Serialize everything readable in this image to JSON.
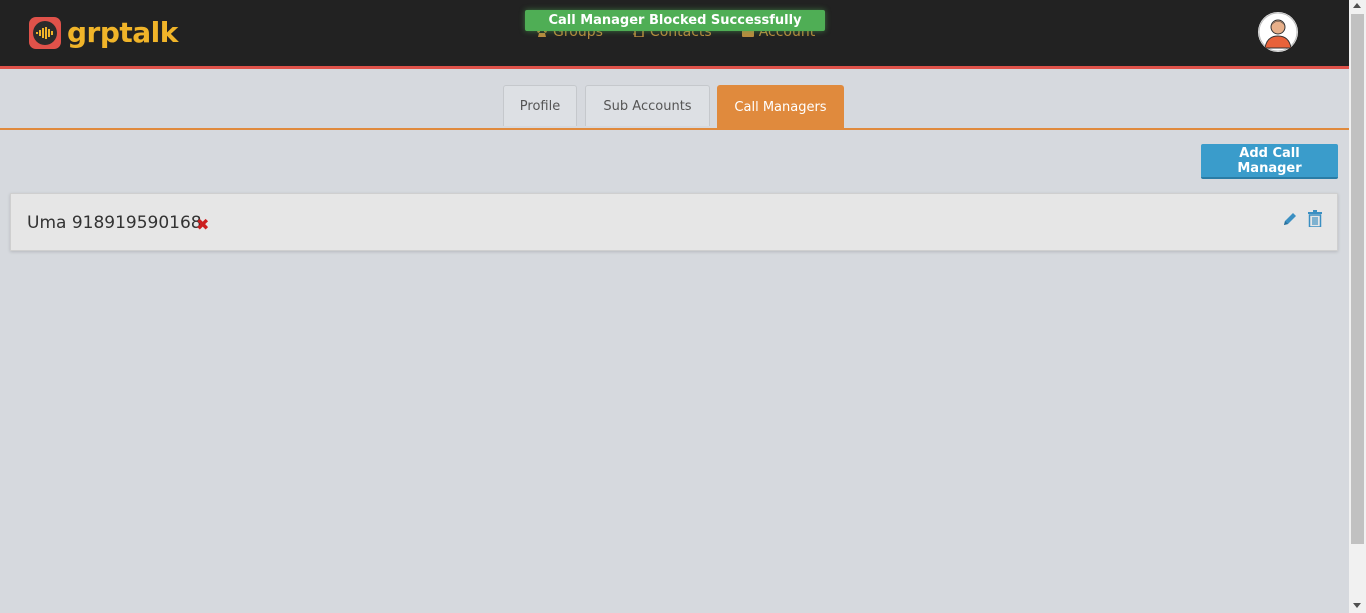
{
  "header": {
    "logo_text": "grptalk",
    "nav": [
      {
        "label": "Groups",
        "icon": "phone-icon"
      },
      {
        "label": "Contacts",
        "icon": "contacts-book-icon"
      },
      {
        "label": "Account",
        "icon": "briefcase-icon"
      }
    ],
    "toast": "Call Manager Blocked Successfully"
  },
  "tabs": [
    {
      "label": "Profile",
      "active": false
    },
    {
      "label": "Sub Accounts",
      "active": false
    },
    {
      "label": "Call Managers",
      "active": true
    }
  ],
  "toolbar": {
    "add_label": "Add Call Manager"
  },
  "managers": [
    {
      "name": "Uma 918919590168",
      "blocked_icon": "x-icon"
    }
  ],
  "colors": {
    "topbar": "#222222",
    "accent_red": "#e0524a",
    "tab_active": "#e08a3d",
    "button_blue": "#3a9ccb",
    "toast_green": "#4fae55",
    "logo_yellow": "#f0b429"
  }
}
